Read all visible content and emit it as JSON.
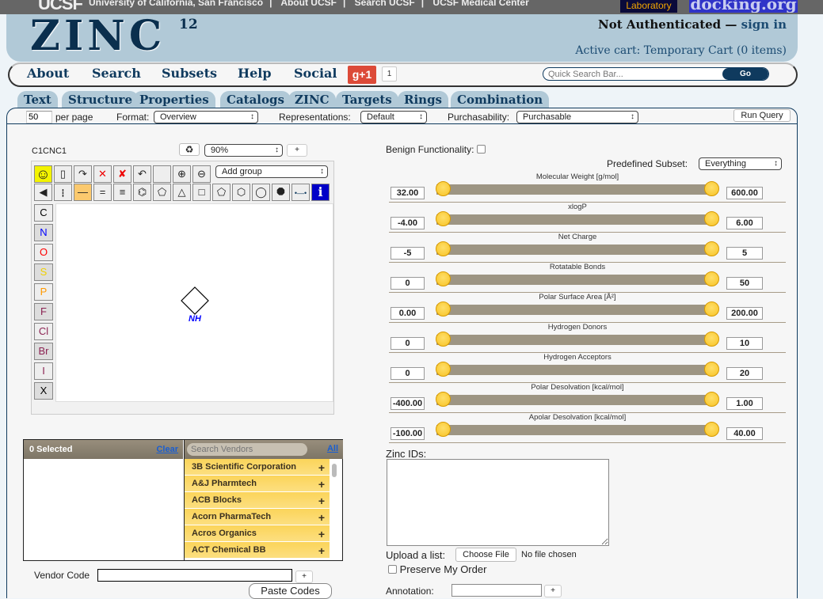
{
  "topbar": {
    "logo": "UCSF",
    "links": [
      "University of California, San Francisco",
      "About UCSF",
      "Search UCSF",
      "UCSF Medical Center"
    ],
    "lab_badge": "Laboratory",
    "docking_badge": "docking.org"
  },
  "header": {
    "title": "ZINC",
    "version": "12",
    "auth_status": "Not Authenticated",
    "auth_dash": " — ",
    "sign_in": "sign in",
    "cart": "Active cart: Temporary Cart (0 items)"
  },
  "nav": {
    "items": [
      "About",
      "Search",
      "Subsets",
      "Help",
      "Social"
    ],
    "gplus_label": "g+1",
    "gplus_count": "1",
    "quick_search_placeholder": "Quick Search Bar...",
    "go_label": "Go"
  },
  "tabs": [
    "Text",
    "Structure",
    "Properties",
    "Catalogs",
    "ZINC",
    "Targets",
    "Rings",
    "Combination"
  ],
  "options": {
    "per_page_value": "50",
    "per_page_label": "per page",
    "format_label": "Format:",
    "format_value": "Overview",
    "representations_label": "Representations:",
    "representations_value": "Default",
    "purchasability_label": "Purchasability:",
    "purchasability_value": "Purchasable",
    "run_query": "Run Query"
  },
  "sketcher": {
    "smiles": "C1CNC1",
    "recycle_icon": "♻",
    "zoom_value": "90%",
    "zoom_plus": "+",
    "add_group": "Add group",
    "toolbar_row1": [
      {
        "name": "smiley-icon",
        "glyph": "☺"
      },
      {
        "name": "new-page-icon",
        "glyph": "▯"
      },
      {
        "name": "rotate-add-icon",
        "glyph": "↷"
      },
      {
        "name": "delete-icon",
        "glyph": "✕"
      },
      {
        "name": "clear-all-icon",
        "glyph": "✘"
      },
      {
        "name": "undo-icon",
        "glyph": "↶"
      },
      {
        "name": "blank-tool-icon",
        "glyph": ""
      },
      {
        "name": "charge-plus-icon",
        "glyph": "⊕"
      },
      {
        "name": "charge-minus-icon",
        "glyph": "⊖"
      }
    ],
    "toolbar_row2": [
      {
        "name": "wedge-bond-icon",
        "glyph": "◀"
      },
      {
        "name": "hash-bond-icon",
        "glyph": "┇"
      },
      {
        "name": "single-bond-icon",
        "glyph": "—"
      },
      {
        "name": "double-bond-icon",
        "glyph": "="
      },
      {
        "name": "triple-bond-icon",
        "glyph": "≡"
      },
      {
        "name": "benzene-icon",
        "glyph": "⌬"
      },
      {
        "name": "cyclopentadiene-icon",
        "glyph": "⬠"
      },
      {
        "name": "triangle-ring-icon",
        "glyph": "△"
      },
      {
        "name": "square-ring-icon",
        "glyph": "□"
      },
      {
        "name": "pentagon-ring-icon",
        "glyph": "⬠"
      },
      {
        "name": "hexagon-ring-icon",
        "glyph": "⬡"
      },
      {
        "name": "heptagon-ring-icon",
        "glyph": "◯"
      },
      {
        "name": "octagon-ring-icon",
        "glyph": "⯃"
      },
      {
        "name": "chain-icon",
        "glyph": "•—•"
      },
      {
        "name": "info-icon",
        "glyph": "i"
      }
    ],
    "atoms": [
      {
        "symbol": "C",
        "color": "#000000"
      },
      {
        "symbol": "N",
        "color": "#0000ff"
      },
      {
        "symbol": "O",
        "color": "#ff0000"
      },
      {
        "symbol": "S",
        "color": "#f0d000"
      },
      {
        "symbol": "P",
        "color": "#ff9900"
      },
      {
        "symbol": "F",
        "color": "#8b2252"
      },
      {
        "symbol": "Cl",
        "color": "#8b2252"
      },
      {
        "symbol": "Br",
        "color": "#8b2252"
      },
      {
        "symbol": "I",
        "color": "#8b2252"
      },
      {
        "symbol": "X",
        "color": "#000000"
      }
    ],
    "molecule_label": "NH"
  },
  "vendors": {
    "selected_label": "0 Selected",
    "clear": "Clear",
    "search_placeholder": "Search Vendors",
    "all": "All",
    "list": [
      "3B Scientific Corporation",
      "A&J Pharmtech",
      "ACB Blocks",
      "Acorn PharmaTech",
      "Acros Organics",
      "ACT Chemical BB"
    ],
    "vendor_code_label": "Vendor Code",
    "vendor_plus": "+",
    "paste_codes": "Paste Codes"
  },
  "properties": {
    "benign_label": "Benign Functionality:",
    "subset_label": "Predefined Subset:",
    "subset_value": "Everything",
    "ranges": [
      {
        "label": "Molecular Weight [g/mol]",
        "min": "32.00",
        "max": "600.00"
      },
      {
        "label": "xlogP",
        "min": "-4.00",
        "max": "6.00"
      },
      {
        "label": "Net Charge",
        "min": "-5",
        "max": "5"
      },
      {
        "label": "Rotatable Bonds",
        "min": "0",
        "max": "50"
      },
      {
        "label": "Polar Surface Area [Å²]",
        "min": "0.00",
        "max": "200.00"
      },
      {
        "label": "Hydrogen Donors",
        "min": "0",
        "max": "10"
      },
      {
        "label": "Hydrogen Acceptors",
        "min": "0",
        "max": "20"
      },
      {
        "label": "Polar Desolvation [kcal/mol]",
        "min": "-400.00",
        "max": "1.00"
      },
      {
        "label": "Apolar Desolvation [kcal/mol]",
        "min": "-100.00",
        "max": "40.00"
      }
    ]
  },
  "zinc_ids": {
    "label": "Zinc IDs:",
    "upload_label": "Upload a list:",
    "choose_file": "Choose File",
    "no_file": "No file chosen",
    "preserve_order": "Preserve My Order",
    "annotation_label": "Annotation:",
    "annotation_plus": "+"
  }
}
